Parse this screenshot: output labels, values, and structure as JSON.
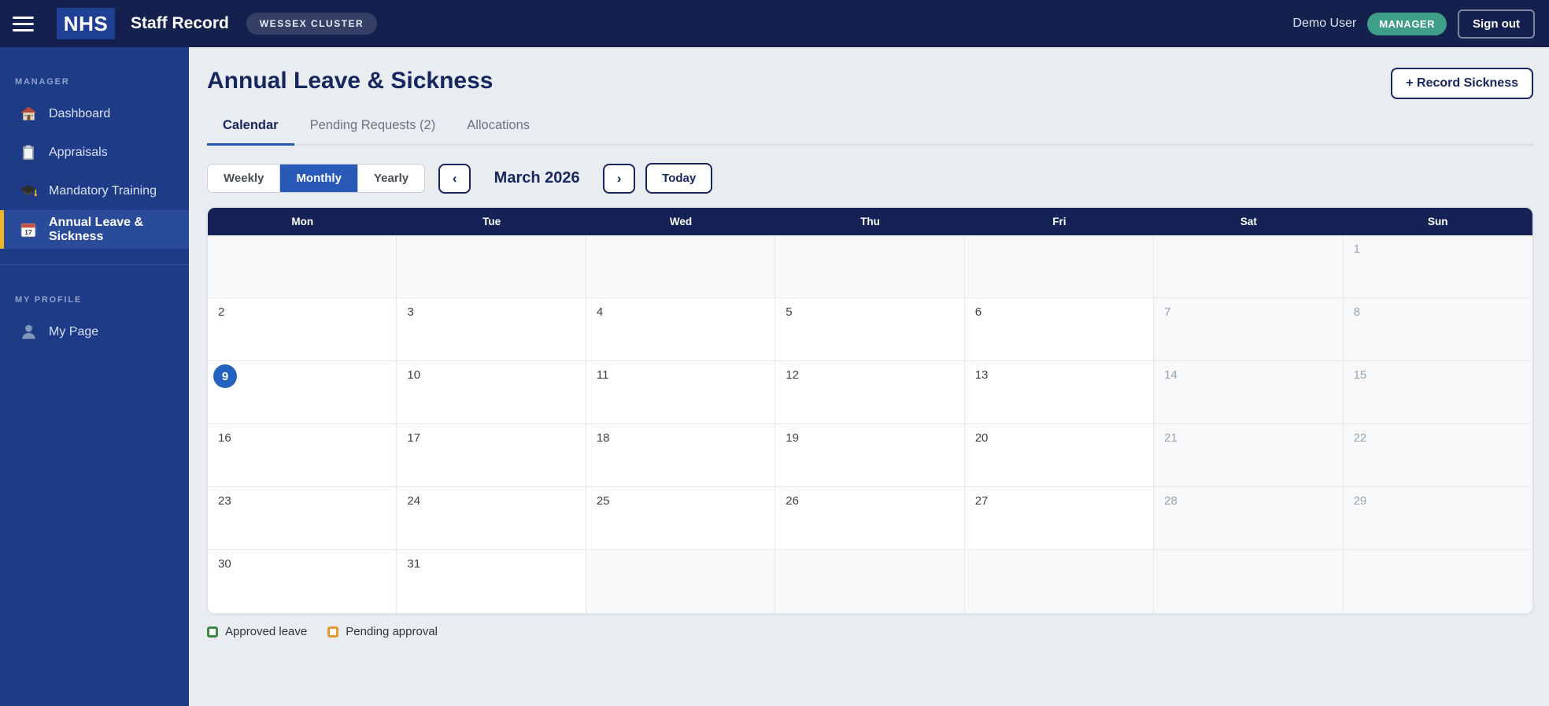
{
  "topbar": {
    "brand": "NHS",
    "app_title": "Staff Record",
    "cluster_badge": "WESSEX CLUSTER",
    "user_name": "Demo User",
    "role_badge": "MANAGER",
    "sign_out_label": "Sign out"
  },
  "sidebar": {
    "sections": [
      {
        "label": "MANAGER",
        "items": [
          {
            "label": "Dashboard",
            "icon": "house-icon",
            "active": false
          },
          {
            "label": "Appraisals",
            "icon": "clipboard-icon",
            "active": false
          },
          {
            "label": "Mandatory Training",
            "icon": "graduation-cap-icon",
            "active": false
          },
          {
            "label": "Annual Leave & Sickness",
            "icon": "calendar-icon",
            "active": true
          }
        ]
      },
      {
        "label": "MY PROFILE",
        "items": [
          {
            "label": "My Page",
            "icon": "person-icon",
            "active": false
          }
        ]
      }
    ]
  },
  "main": {
    "page_title": "Annual Leave & Sickness",
    "record_sickness_label": "+ Record Sickness",
    "tabs": [
      {
        "label": "Calendar",
        "active": true
      },
      {
        "label": "Pending Requests (2)",
        "active": false
      },
      {
        "label": "Allocations",
        "active": false
      }
    ],
    "view_toggle": [
      {
        "label": "Weekly",
        "active": false
      },
      {
        "label": "Monthly",
        "active": true
      },
      {
        "label": "Yearly",
        "active": false
      }
    ],
    "prev_label": "‹",
    "next_label": "›",
    "today_label": "Today",
    "current_period": "March 2026"
  },
  "calendar": {
    "day_headers": [
      "Mon",
      "Tue",
      "Wed",
      "Thu",
      "Fri",
      "Sat",
      "Sun"
    ],
    "weeks": [
      [
        "",
        "",
        "",
        "",
        "",
        "",
        "1"
      ],
      [
        "2",
        "3",
        "4",
        "5",
        "6",
        "7",
        "8"
      ],
      [
        "9",
        "10",
        "11",
        "12",
        "13",
        "14",
        "15"
      ],
      [
        "16",
        "17",
        "18",
        "19",
        "20",
        "21",
        "22"
      ],
      [
        "23",
        "24",
        "25",
        "26",
        "27",
        "28",
        "29"
      ],
      [
        "30",
        "31",
        "",
        "",
        "",
        "",
        ""
      ]
    ],
    "today": "9"
  },
  "legend": [
    {
      "label": "Approved leave",
      "color": "#3d8b40"
    },
    {
      "label": "Pending approval",
      "color": "#e8992e"
    }
  ],
  "colors": {
    "topbar_navy": "#14214f",
    "sidebar_blue": "#1e3b88",
    "active_item_bar": "#f0b429",
    "accent_blue": "#2a5ab8",
    "heading_navy": "#16265e",
    "today_circle": "#2361be",
    "role_badge_teal": "#3f9e88",
    "approved_green": "#3d8b40",
    "pending_orange": "#e8992e"
  }
}
